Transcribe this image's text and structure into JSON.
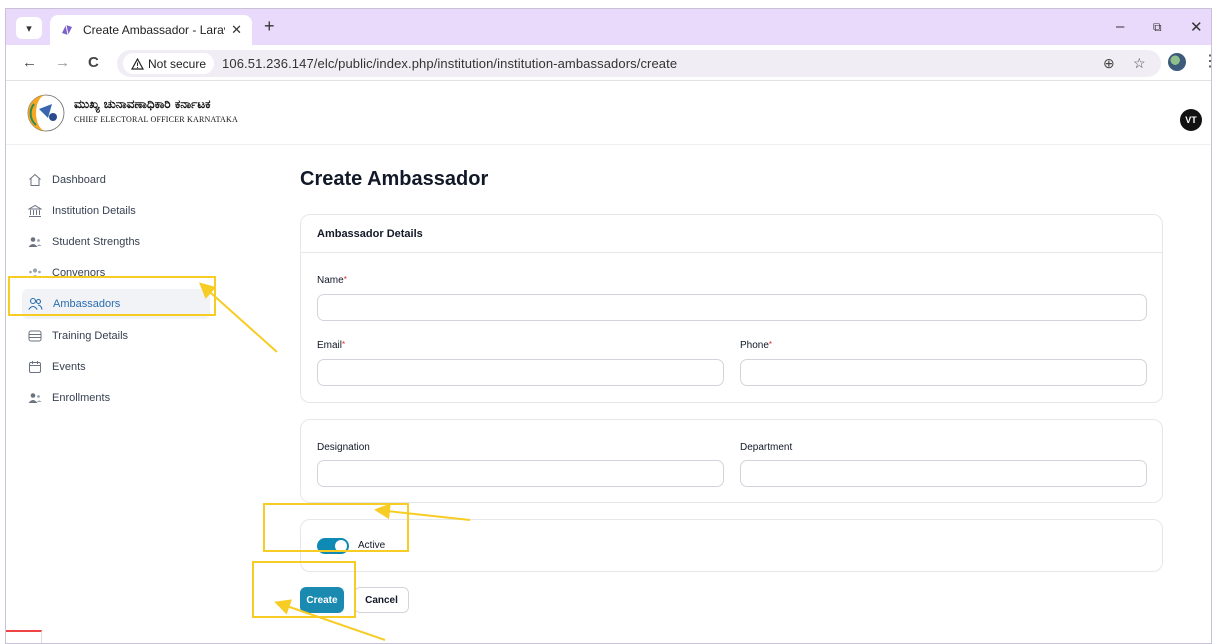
{
  "browser": {
    "tab_title": "Create Ambassador - Laravel",
    "tab_close": "✕",
    "new_tab": "+",
    "security_chip": "Not secure",
    "url": "106.51.236.147/elc/public/index.php/institution/institution-ambassadors/create",
    "window_controls": {
      "minimize": "–",
      "restore": "⧉",
      "close": "✕"
    }
  },
  "header": {
    "org_name_kannada": "ಮುಖ್ಯ ಚುನಾವಣಾಧಿಕಾರಿ ಕರ್ನಾಟಕ",
    "org_name_english": "CHIEF ELECTORAL OFFICER KARNATAKA",
    "avatar_initials": "VT"
  },
  "sidebar": {
    "items": [
      {
        "label": "Dashboard",
        "icon": "home-icon"
      },
      {
        "label": "Institution Details",
        "icon": "institution-icon"
      },
      {
        "label": "Student Strengths",
        "icon": "users-icon"
      },
      {
        "label": "Convenors",
        "icon": "users-icon"
      },
      {
        "label": "Ambassadors",
        "icon": "user-group-icon",
        "active": true
      },
      {
        "label": "Training Details",
        "icon": "stack-icon"
      },
      {
        "label": "Events",
        "icon": "calendar-icon"
      },
      {
        "label": "Enrollments",
        "icon": "users-icon"
      }
    ]
  },
  "main": {
    "page_title": "Create Ambassador",
    "details_card": {
      "heading": "Ambassador Details",
      "name_label": "Name",
      "email_label": "Email",
      "phone_label": "Phone",
      "required_mark": "*",
      "name_value": "",
      "email_value": "",
      "phone_value": ""
    },
    "extra_card": {
      "designation_label": "Designation",
      "department_label": "Department",
      "designation_value": "",
      "department_value": ""
    },
    "status_card": {
      "toggle_label": "Active",
      "toggle_on": true
    },
    "buttons": {
      "create": "Create",
      "cancel": "Cancel"
    }
  },
  "colors": {
    "accent": "#1b8ab1",
    "highlight": "#f7cc25",
    "tabbar": "#e9d9fb"
  }
}
